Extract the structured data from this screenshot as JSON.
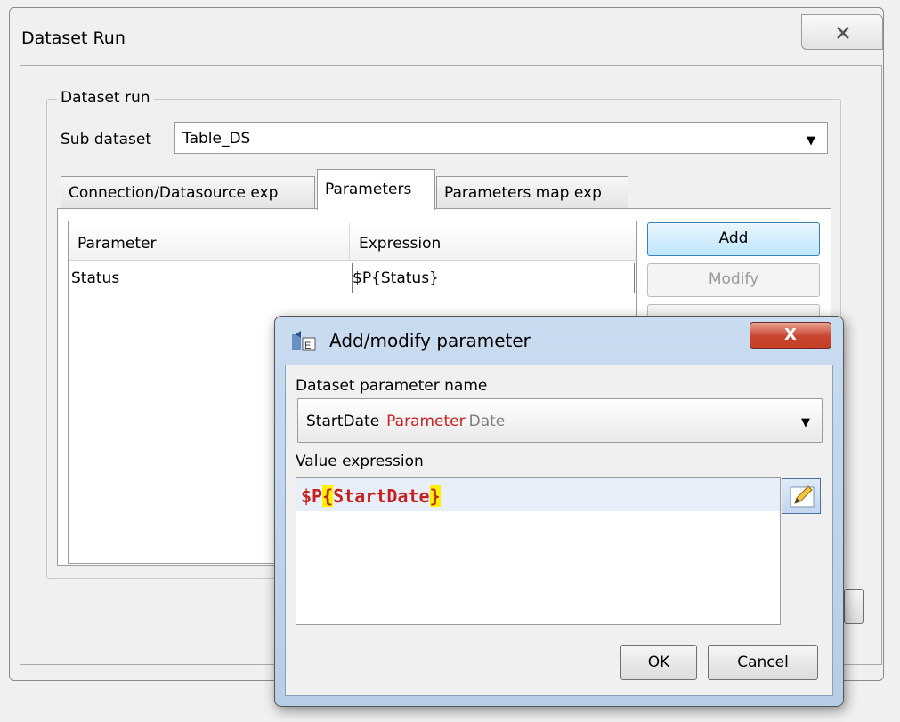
{
  "outer_dialog": {
    "title": "Dataset Run",
    "close_glyph": "✕"
  },
  "dataset_run": {
    "group_label": "Dataset run",
    "sub_dataset_label": "Sub dataset",
    "sub_dataset_value": "Table_DS",
    "tabs": [
      {
        "label": "Connection/Datasource exp"
      },
      {
        "label": "Parameters"
      },
      {
        "label": "Parameters map exp"
      }
    ],
    "table": {
      "columns": [
        "Parameter",
        "Expression"
      ],
      "rows": [
        {
          "parameter": "Status",
          "expression": "$P{Status}"
        }
      ]
    },
    "buttons": {
      "add": "Add",
      "modify": "Modify"
    }
  },
  "inner_dialog": {
    "title": "Add/modify parameter",
    "close_glyph": "X",
    "dataset_param_label": "Dataset parameter name",
    "dataset_param": {
      "name": "StartDate",
      "kind": "Parameter",
      "type": "Date"
    },
    "value_expression_label": "Value expression",
    "expression": {
      "prefix": "$P",
      "open": "{",
      "body": "StartDate",
      "close": "}"
    },
    "ok_label": "OK",
    "cancel_label": "Cancel"
  },
  "colors": {
    "accent_blue": "#bee6fd",
    "close_red": "#c8452f",
    "param_red": "#c42121",
    "highlight_yellow": "#fff200"
  }
}
